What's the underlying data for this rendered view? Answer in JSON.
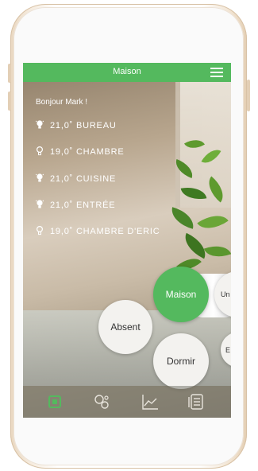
{
  "app": {
    "title": "Maison",
    "greeting": "Bonjour Mark !",
    "accent_color": "#54b95e"
  },
  "rooms": [
    {
      "temperature": "21,0˚",
      "name": "BUREAU",
      "icon": "bulb-on-icon"
    },
    {
      "temperature": "19,0˚",
      "name": "CHAMBRE",
      "icon": "bulb-off-icon"
    },
    {
      "temperature": "21,0˚",
      "name": "CUISINE",
      "icon": "bulb-on-icon"
    },
    {
      "temperature": "21,0˚",
      "name": "ENTRÉE",
      "icon": "bulb-on-icon"
    },
    {
      "temperature": "19,0˚",
      "name": "CHAMBRE D'ERIC",
      "icon": "bulb-off-icon"
    }
  ],
  "modes": {
    "maison": "Maison",
    "absent": "Absent",
    "dormir": "Dormir",
    "partial_1": "Un",
    "partial_2": "E"
  },
  "nav": [
    {
      "name": "home-nav",
      "icon": "home-icon",
      "active": true
    },
    {
      "name": "scenes-nav",
      "icon": "bubbles-icon",
      "active": false
    },
    {
      "name": "stats-nav",
      "icon": "chart-icon",
      "active": false
    },
    {
      "name": "history-nav",
      "icon": "list-icon",
      "active": false
    }
  ]
}
